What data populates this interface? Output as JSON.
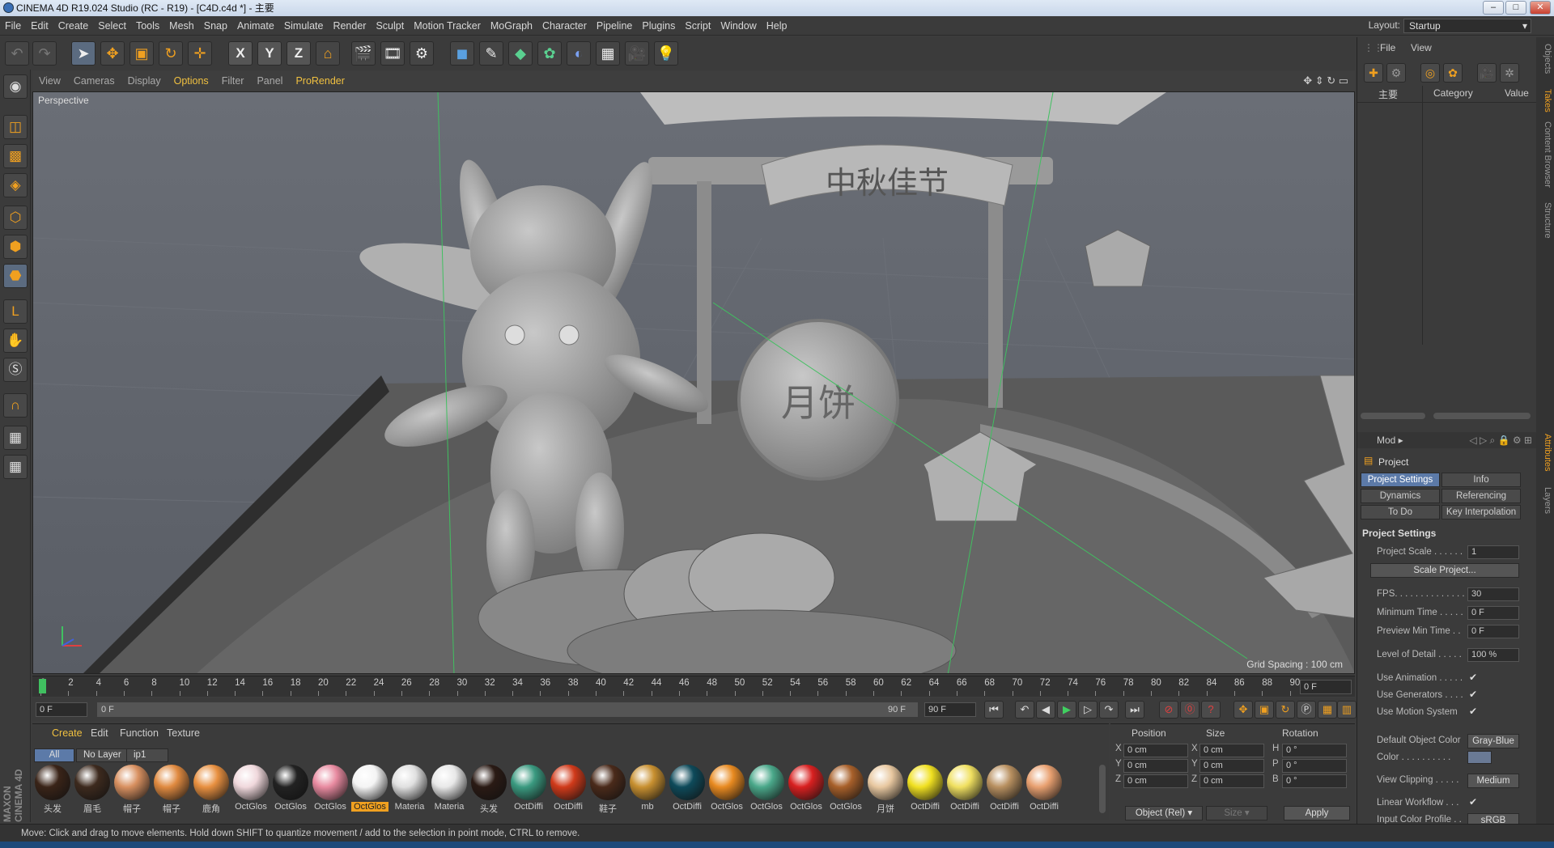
{
  "window": {
    "title": "CINEMA 4D R19.024 Studio (RC - R19) - [C4D.c4d *] - 主要"
  },
  "menu": [
    "File",
    "Edit",
    "Create",
    "Select",
    "Tools",
    "Mesh",
    "Snap",
    "Animate",
    "Simulate",
    "Render",
    "Sculpt",
    "Motion Tracker",
    "MoGraph",
    "Character",
    "Pipeline",
    "Plugins",
    "Script",
    "Window",
    "Help"
  ],
  "layout": {
    "label": "Layout:",
    "value": "Startup"
  },
  "toolbar": {
    "axis_x": "X",
    "axis_y": "Y",
    "axis_z": "Z"
  },
  "viewport_menu": [
    "View",
    "Cameras",
    "Display",
    "Options",
    "Filter",
    "Panel",
    "ProRender"
  ],
  "viewport": {
    "label": "Perspective",
    "grid_spacing": "Grid Spacing : 100 cm",
    "sign_text": "中秋佳节",
    "mooncake_text": "月饼"
  },
  "timeline": {
    "ticks": [
      "0",
      "2",
      "4",
      "6",
      "8",
      "10",
      "12",
      "14",
      "16",
      "18",
      "20",
      "22",
      "24",
      "26",
      "28",
      "30",
      "32",
      "34",
      "36",
      "38",
      "40",
      "42",
      "44",
      "46",
      "48",
      "50",
      "52",
      "54",
      "56",
      "58",
      "60",
      "62",
      "64",
      "66",
      "68",
      "70",
      "72",
      "74",
      "76",
      "78",
      "80",
      "82",
      "84",
      "86",
      "88",
      "90"
    ],
    "current": "0 F"
  },
  "playbar": {
    "start": "0 F",
    "range_start": "0 F",
    "range_end": "90 F",
    "end": "90 F"
  },
  "material_manager": {
    "menu": [
      "Create",
      "Edit",
      "Function",
      "Texture"
    ],
    "tabs": [
      "All",
      "No Layer",
      "ip1"
    ],
    "materials": [
      {
        "name": "头发",
        "color": "#3a2418"
      },
      {
        "name": "眉毛",
        "color": "#3d2a1e"
      },
      {
        "name": "帽子",
        "color": "#d89060"
      },
      {
        "name": "帽子",
        "color": "#e08a40"
      },
      {
        "name": "鹿角",
        "color": "#e89040"
      },
      {
        "name": "OctGlos",
        "color": "#f0d8dc"
      },
      {
        "name": "OctGlos",
        "color": "#222222"
      },
      {
        "name": "OctGlos",
        "color": "#e88aa0"
      },
      {
        "name": "OctGlos",
        "color": "#f4f4f4",
        "selected": true
      },
      {
        "name": "Materia",
        "color": "#e0e0e0"
      },
      {
        "name": "Materia",
        "color": "#e8e8e8"
      },
      {
        "name": "头发",
        "color": "#2a1a14"
      },
      {
        "name": "OctDiffi",
        "color": "#3a9a80"
      },
      {
        "name": "OctDiffi",
        "color": "#d03a1a"
      },
      {
        "name": "鞋子",
        "color": "#4a2a1a"
      },
      {
        "name": "mb",
        "color": "#c89030"
      },
      {
        "name": "OctDiffi",
        "color": "#0e4a5a"
      },
      {
        "name": "OctGlos",
        "color": "#e88a20"
      },
      {
        "name": "OctGlos",
        "color": "#4aa88a"
      },
      {
        "name": "OctGlos",
        "color": "#d82020"
      },
      {
        "name": "OctGlos",
        "color": "#a8602a"
      },
      {
        "name": "月饼",
        "color": "#e8c8a0"
      },
      {
        "name": "OctDiffi",
        "color": "#f0e020"
      },
      {
        "name": "OctDiffi",
        "color": "#f0e060"
      },
      {
        "name": "OctDiffi",
        "color": "#b89060"
      },
      {
        "name": "OctDiffi",
        "color": "#e8a070"
      }
    ]
  },
  "coordinates": {
    "headers": [
      "Position",
      "Size",
      "Rotation"
    ],
    "rows": [
      {
        "axis": "X",
        "pos": "0 cm",
        "size_axis": "X",
        "size": "0 cm",
        "rot_axis": "H",
        "rot": "0 °"
      },
      {
        "axis": "Y",
        "pos": "0 cm",
        "size_axis": "Y",
        "size": "0 cm",
        "rot_axis": "P",
        "rot": "0 °"
      },
      {
        "axis": "Z",
        "pos": "0 cm",
        "size_axis": "Z",
        "size": "0 cm",
        "rot_axis": "B",
        "rot": "0 °"
      }
    ],
    "mode": "Object (Rel)",
    "size_mode": "Size",
    "apply": "Apply"
  },
  "status": "Move: Click and drag to move elements. Hold down SHIFT to quantize movement / add to the selection in point mode, CTRL to remove.",
  "object_manager": {
    "menu": [
      "File",
      "View"
    ],
    "columns": [
      "主要",
      "Category",
      "Value"
    ]
  },
  "attributes": {
    "mode": "Mod",
    "object": "Project",
    "tabs": [
      "Project Settings",
      "Info",
      "Dynamics",
      "Referencing",
      "To Do",
      "Key Interpolation"
    ],
    "section": "Project Settings",
    "rows": [
      {
        "label": "Project Scale . . . . . .",
        "value": "1"
      },
      {
        "label": "FPS. . . . . . . . . . . . . .",
        "value": "30"
      },
      {
        "label": "Minimum Time . . . . .",
        "value": "0 F"
      },
      {
        "label": "Preview Min Time . .",
        "value": "0 F"
      },
      {
        "label": "Level of Detail . . . . .",
        "value": "100 %"
      }
    ],
    "scale_button": "Scale Project...",
    "checks": [
      {
        "label": "Use Animation . . . . .",
        "value": "✔"
      },
      {
        "label": "Use Generators . . . .",
        "value": "✔"
      },
      {
        "label": "Use Motion System",
        "value": "✔"
      }
    ],
    "default_color_label": "Default Object Color",
    "default_color_value": "Gray-Blue",
    "color_label": "Color . . . . . . . . . .",
    "clipping_label": "View Clipping . . . . .",
    "clipping_value": "Medium",
    "linear_label": "Linear Workflow . . .",
    "linear_value": "✔",
    "input_profile_label": "Input Color Profile . .",
    "input_profile_value": "sRGB"
  },
  "side_tabs": [
    "Objects",
    "Takes",
    "Content Browser",
    "Structure",
    "Attributes",
    "Layers"
  ],
  "brand": "MAXON CINEMA 4D"
}
